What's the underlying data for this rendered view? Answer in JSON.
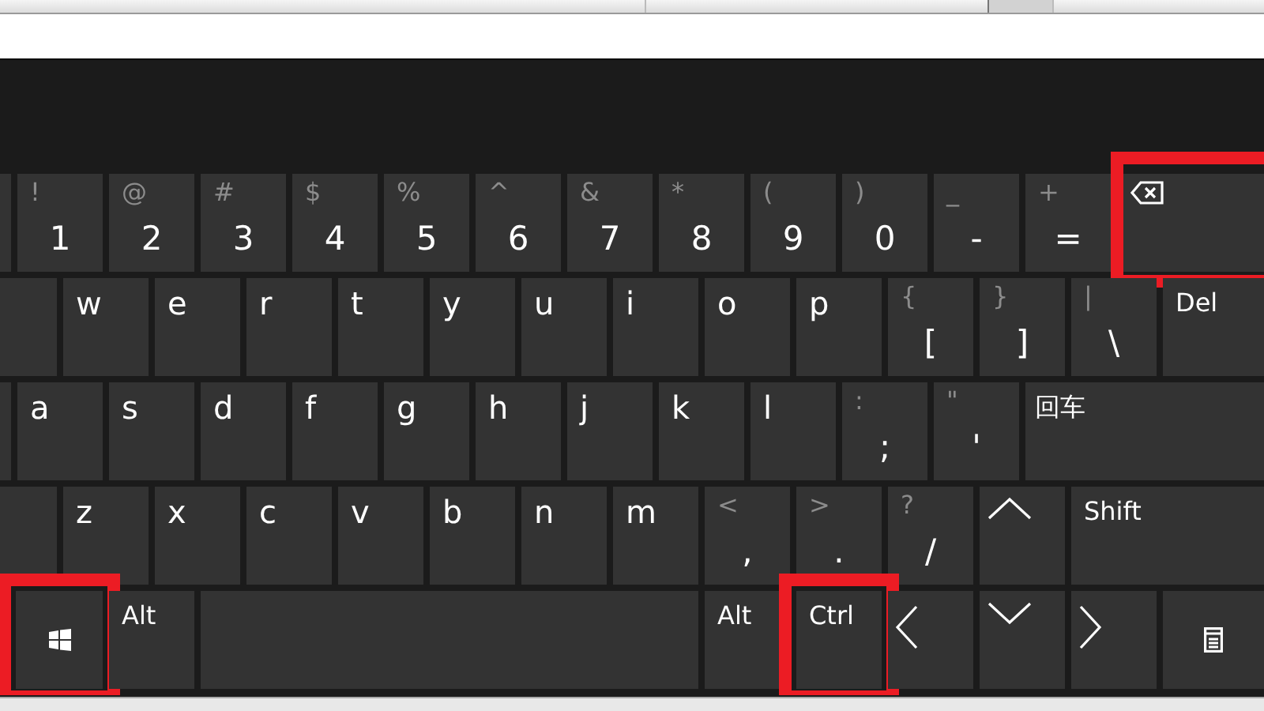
{
  "keyboard": {
    "rows": [
      {
        "keys": [
          {
            "kind": "blank"
          },
          {
            "kind": "dual",
            "upper": "!",
            "lower": "1"
          },
          {
            "kind": "dual",
            "upper": "@",
            "lower": "2"
          },
          {
            "kind": "dual",
            "upper": "#",
            "lower": "3"
          },
          {
            "kind": "dual",
            "upper": "$",
            "lower": "4"
          },
          {
            "kind": "dual",
            "upper": "%",
            "lower": "5"
          },
          {
            "kind": "dual",
            "upper": "^",
            "lower": "6"
          },
          {
            "kind": "dual",
            "upper": "&",
            "lower": "7"
          },
          {
            "kind": "dual",
            "upper": "*",
            "lower": "8"
          },
          {
            "kind": "dual",
            "upper": "(",
            "lower": "9"
          },
          {
            "kind": "dual",
            "upper": ")",
            "lower": "0"
          },
          {
            "kind": "dual",
            "upper": "_",
            "lower": "-"
          },
          {
            "kind": "dual",
            "upper": "+",
            "lower": "="
          },
          {
            "kind": "backspace",
            "highlighted": true
          }
        ]
      },
      {
        "keys": [
          {
            "kind": "blank-wide"
          },
          {
            "kind": "letter",
            "label": "w"
          },
          {
            "kind": "letter",
            "label": "e"
          },
          {
            "kind": "letter",
            "label": "r"
          },
          {
            "kind": "letter",
            "label": "t"
          },
          {
            "kind": "letter",
            "label": "y"
          },
          {
            "kind": "letter",
            "label": "u"
          },
          {
            "kind": "letter",
            "label": "i"
          },
          {
            "kind": "letter",
            "label": "o"
          },
          {
            "kind": "letter",
            "label": "p"
          },
          {
            "kind": "dual",
            "upper": "{",
            "lower": "["
          },
          {
            "kind": "dual",
            "upper": "}",
            "lower": "]"
          },
          {
            "kind": "dual",
            "upper": "|",
            "lower": "\\"
          },
          {
            "kind": "text",
            "label": "Del"
          }
        ]
      },
      {
        "keys": [
          {
            "kind": "blank"
          },
          {
            "kind": "letter",
            "label": "a"
          },
          {
            "kind": "letter",
            "label": "s"
          },
          {
            "kind": "letter",
            "label": "d"
          },
          {
            "kind": "letter",
            "label": "f"
          },
          {
            "kind": "letter",
            "label": "g"
          },
          {
            "kind": "letter",
            "label": "h"
          },
          {
            "kind": "letter",
            "label": "j"
          },
          {
            "kind": "letter",
            "label": "k"
          },
          {
            "kind": "letter",
            "label": "l"
          },
          {
            "kind": "dual",
            "upper": ":",
            "lower": ";"
          },
          {
            "kind": "dual",
            "upper": "\"",
            "lower": "'"
          },
          {
            "kind": "text",
            "label": "回车"
          }
        ]
      },
      {
        "keys": [
          {
            "kind": "blank-wide"
          },
          {
            "kind": "letter",
            "label": "z"
          },
          {
            "kind": "letter",
            "label": "x"
          },
          {
            "kind": "letter",
            "label": "c"
          },
          {
            "kind": "letter",
            "label": "v"
          },
          {
            "kind": "letter",
            "label": "b"
          },
          {
            "kind": "letter",
            "label": "n"
          },
          {
            "kind": "letter",
            "label": "m"
          },
          {
            "kind": "dual",
            "upper": "<",
            "lower": ","
          },
          {
            "kind": "dual",
            "upper": ">",
            "lower": "."
          },
          {
            "kind": "dual",
            "upper": "?",
            "lower": "/"
          },
          {
            "kind": "up"
          },
          {
            "kind": "text",
            "label": "Shift"
          }
        ]
      },
      {
        "keys": [
          {
            "kind": "windows",
            "highlighted": true
          },
          {
            "kind": "text",
            "label": "Alt"
          },
          {
            "kind": "space"
          },
          {
            "kind": "text",
            "label": "Alt"
          },
          {
            "kind": "text",
            "label": "Ctrl",
            "highlighted": true
          },
          {
            "kind": "left"
          },
          {
            "kind": "down"
          },
          {
            "kind": "right"
          },
          {
            "kind": "menu"
          }
        ]
      }
    ]
  }
}
